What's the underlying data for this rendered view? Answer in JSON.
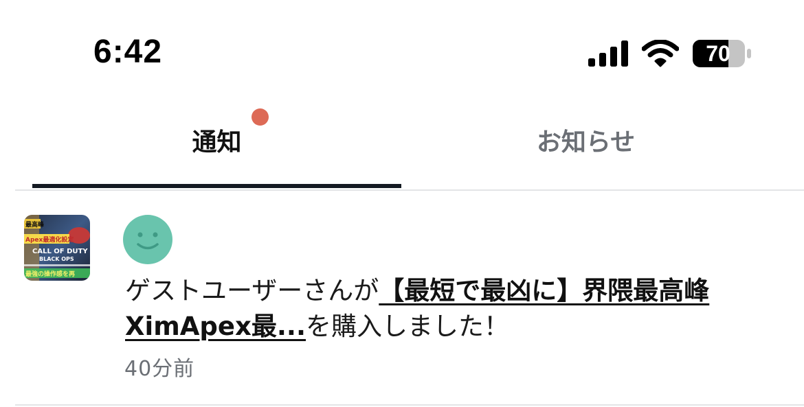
{
  "status_bar": {
    "time": "6:42",
    "battery": "70",
    "icons": [
      "cellular-signal-icon",
      "wifi-icon",
      "battery-icon"
    ]
  },
  "tabs": [
    {
      "label": "通知",
      "active": true,
      "has_dot": true
    },
    {
      "label": "お知らせ",
      "active": false,
      "has_dot": false
    }
  ],
  "notification": {
    "prefix": "ゲストユーザーさんが",
    "link_line1": "【最短で最凶に】界隈最高峰",
    "link_line2": "XimApex最...",
    "suffix": "を購入しました！",
    "time": "40分前",
    "thumbnail_text": {
      "top": "最高峰",
      "line": "Apex最適化設定",
      "game_title": "CALL OF DUTY",
      "game_subtitle": "BLACK OPS",
      "bottom": "最強の操作感を再"
    }
  },
  "colors": {
    "accent_dot": "#dd6a56",
    "avatar": "#69c4ad",
    "underline": "#141a22",
    "muted_text": "#6b6f75",
    "divider": "#e3e4e6"
  }
}
